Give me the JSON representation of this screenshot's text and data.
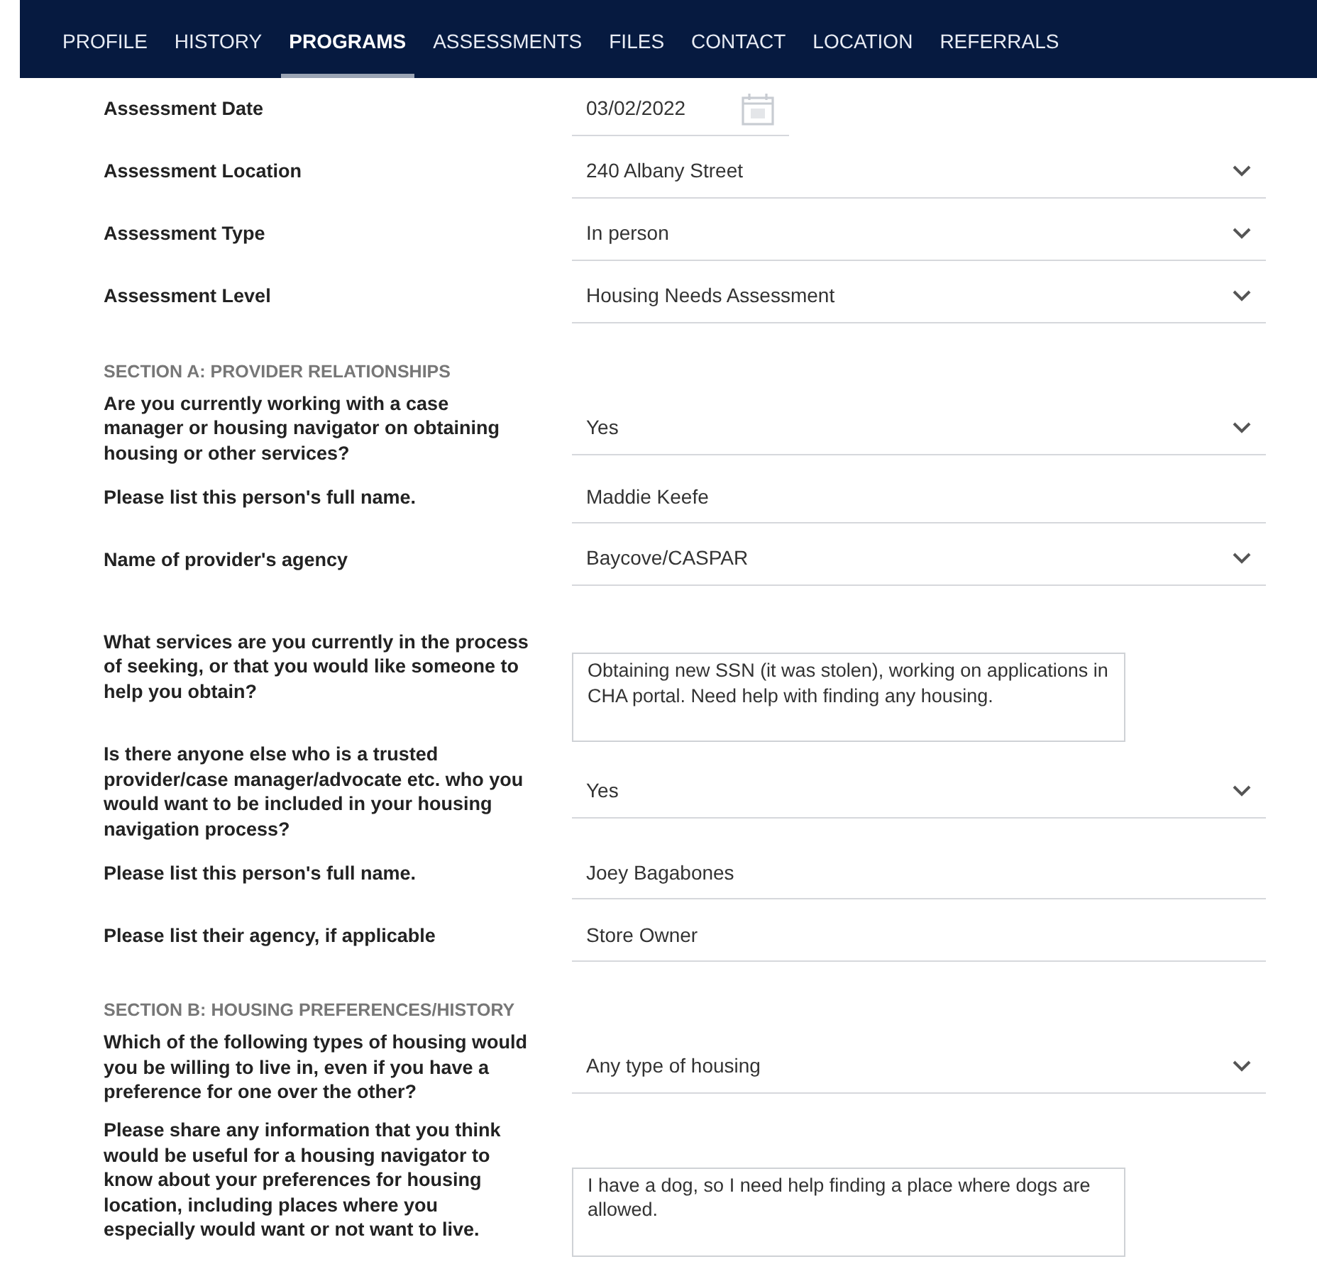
{
  "tabs": [
    {
      "label": "PROFILE",
      "selected": false
    },
    {
      "label": "HISTORY",
      "selected": false
    },
    {
      "label": "PROGRAMS",
      "selected": true
    },
    {
      "label": "ASSESSMENTS",
      "selected": false
    },
    {
      "label": "FILES",
      "selected": false
    },
    {
      "label": "CONTACT",
      "selected": false
    },
    {
      "label": "LOCATION",
      "selected": false
    },
    {
      "label": "REFERRALS",
      "selected": false
    }
  ],
  "form": [
    {
      "kind": "date",
      "label": "Assessment Date",
      "value": "03/02/2022"
    },
    {
      "kind": "select",
      "label": "Assessment Location",
      "value": "240 Albany Street"
    },
    {
      "kind": "select",
      "label": "Assessment Type",
      "value": "In person"
    },
    {
      "kind": "select",
      "label": "Assessment Level",
      "value": "Housing Needs Assessment"
    },
    {
      "kind": "section",
      "label": "SECTION A: PROVIDER RELATIONSHIPS"
    },
    {
      "kind": "select",
      "label": "Are you currently working with a case manager or housing navigator on obtaining housing or other services?",
      "value": "Yes"
    },
    {
      "kind": "text",
      "label": "Please list this person's full name.",
      "value": "Maddie Keefe"
    },
    {
      "kind": "select",
      "label": "Name of provider's agency",
      "value": "Baycove/CASPAR"
    },
    {
      "kind": "textarea",
      "label": "What services are you currently in the process of seeking, or that you would like someone to help you obtain?",
      "value": "Obtaining new SSN (it was stolen), working on applications in CHA portal. Need help with finding any housing."
    },
    {
      "kind": "select",
      "label": "Is there anyone else who is a trusted provider/case manager/advocate etc. who you would want to be included in your housing navigation process?",
      "value": "Yes"
    },
    {
      "kind": "text",
      "label": "Please list this person's full name.",
      "value": "Joey Bagabones"
    },
    {
      "kind": "text",
      "label": "Please list their agency, if applicable",
      "value": "Store Owner"
    },
    {
      "kind": "section",
      "label": "SECTION B: HOUSING PREFERENCES/HISTORY"
    },
    {
      "kind": "select",
      "label": "Which of the following types of housing would you be willing to live in, even if you have a preference for one over the other?",
      "value": "Any type of housing"
    },
    {
      "kind": "textarea",
      "label": "Please share any information that you think would be useful for a housing navigator to know about your preferences for housing location, including places where you especially would want or not want to live.",
      "value": "I have a dog, so I need help finding a place where dogs are allowed."
    }
  ]
}
